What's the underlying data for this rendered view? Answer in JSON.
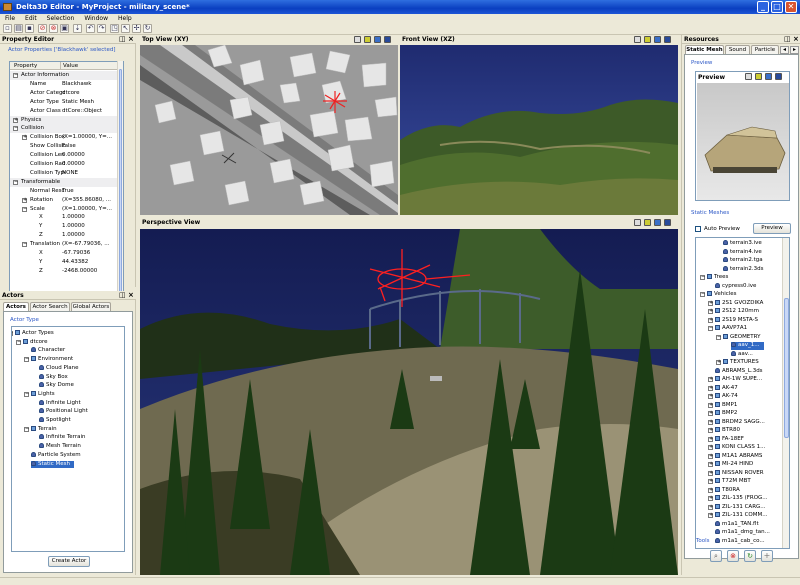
{
  "window": {
    "title": "Delta3D Editor - MyProject - military_scene*",
    "min": "_",
    "max": "□",
    "close": "✕"
  },
  "menu": [
    "File",
    "Edit",
    "Selection",
    "Window",
    "Help"
  ],
  "property_editor": {
    "title": "Property Editor",
    "subtitle": "Actor Properties ['Blackhawk' selected]",
    "col_property": "Property",
    "col_value": "Value",
    "rows": [
      {
        "k": "Actor Information",
        "v": "",
        "level": 0,
        "group": true,
        "exp": "−"
      },
      {
        "k": "Name",
        "v": "Blackhawk",
        "level": 1
      },
      {
        "k": "Actor Category",
        "v": "dtcore",
        "level": 1
      },
      {
        "k": "Actor Type",
        "v": "Static Mesh",
        "level": 1
      },
      {
        "k": "Actor Class",
        "v": "dtCore::Object",
        "level": 1
      },
      {
        "k": "Physics",
        "v": "",
        "level": 0,
        "group": true,
        "exp": "+"
      },
      {
        "k": "Collision",
        "v": "",
        "level": 0,
        "group": true,
        "exp": "−"
      },
      {
        "k": "Collision Box",
        "v": "(X=1.00000, Y=...",
        "level": 1,
        "exp": "+"
      },
      {
        "k": "Show Collisio...",
        "v": "False",
        "level": 1
      },
      {
        "k": "Collision Length",
        "v": "0.00000",
        "level": 1
      },
      {
        "k": "Collision Radius",
        "v": "0.00000",
        "level": 1
      },
      {
        "k": "Collision Type",
        "v": "NONE",
        "level": 1
      },
      {
        "k": "Transformable",
        "v": "",
        "level": 0,
        "group": true,
        "exp": "−"
      },
      {
        "k": "Normal Resc...",
        "v": "True",
        "level": 1
      },
      {
        "k": "Rotation",
        "v": "(X=355.86080, ...",
        "level": 1,
        "exp": "+"
      },
      {
        "k": "Scale",
        "v": "(X=1.00000, Y=...",
        "level": 1,
        "exp": "−"
      },
      {
        "k": "X",
        "v": "1.00000",
        "level": 2
      },
      {
        "k": "Y",
        "v": "1.00000",
        "level": 2
      },
      {
        "k": "Z",
        "v": "1.00000",
        "level": 2
      },
      {
        "k": "Translation",
        "v": "(X=-67.79036, ...",
        "level": 1,
        "exp": "−"
      },
      {
        "k": "X",
        "v": "-67.79036",
        "level": 2
      },
      {
        "k": "Y",
        "v": "44.43382",
        "level": 2
      },
      {
        "k": "Z",
        "v": "-2468.00000",
        "level": 2
      }
    ]
  },
  "actors": {
    "title": "Actors",
    "tabs": [
      "Actors",
      "Actor Search",
      "Global Actors"
    ],
    "group_label": "Actor Type",
    "create_button": "Create Actor",
    "tree": [
      {
        "t": "Actor Types",
        "l": 0,
        "icon": "folder",
        "exp": "−"
      },
      {
        "t": "dtcore",
        "l": 1,
        "icon": "folder",
        "exp": "−"
      },
      {
        "t": "Character",
        "l": 2,
        "icon": "person"
      },
      {
        "t": "Environment",
        "l": 2,
        "icon": "folder",
        "exp": "−"
      },
      {
        "t": "Cloud Plane",
        "l": 3,
        "icon": "person"
      },
      {
        "t": "Sky Box",
        "l": 3,
        "icon": "person"
      },
      {
        "t": "Sky Dome",
        "l": 3,
        "icon": "person"
      },
      {
        "t": "Lights",
        "l": 2,
        "icon": "folder",
        "exp": "−"
      },
      {
        "t": "Infinite Light",
        "l": 3,
        "icon": "person"
      },
      {
        "t": "Positional Light",
        "l": 3,
        "icon": "person"
      },
      {
        "t": "Spotlight",
        "l": 3,
        "icon": "person"
      },
      {
        "t": "Terrain",
        "l": 2,
        "icon": "folder",
        "exp": "−"
      },
      {
        "t": "Infinite Terrain",
        "l": 3,
        "icon": "person"
      },
      {
        "t": "Mesh Terrain",
        "l": 3,
        "icon": "person"
      },
      {
        "t": "Particle System",
        "l": 2,
        "icon": "person"
      },
      {
        "t": "Static Mesh",
        "l": 2,
        "icon": "person",
        "selected": true
      }
    ]
  },
  "views": {
    "top": "Top View (XY)",
    "front": "Front View (XZ)",
    "perspective": "Perspective View"
  },
  "resources": {
    "title": "Resources",
    "tabs": [
      "Static Mesh",
      "Sound",
      "Particle"
    ],
    "preview_group": "Preview",
    "preview_title": "Preview",
    "static_meshes": "Static Meshes",
    "auto_preview": "Auto Preview",
    "preview_button": "Preview",
    "tools": "Tools",
    "tree": [
      {
        "t": "terrain3.ive",
        "l": 3,
        "icon": "person"
      },
      {
        "t": "terrain4.ive",
        "l": 3,
        "icon": "person"
      },
      {
        "t": "terrain2.tga",
        "l": 3,
        "icon": "person"
      },
      {
        "t": "terrain2.3ds",
        "l": 3,
        "icon": "person"
      },
      {
        "t": "Trees",
        "l": 1,
        "icon": "folder",
        "exp": "−"
      },
      {
        "t": "cypress0.ive",
        "l": 2,
        "icon": "person"
      },
      {
        "t": "Vehicles",
        "l": 1,
        "icon": "folder",
        "exp": "−"
      },
      {
        "t": "2S1 GVOZDIKA",
        "l": 2,
        "icon": "folder",
        "exp": "+"
      },
      {
        "t": "2S12 120mm",
        "l": 2,
        "icon": "folder",
        "exp": "+"
      },
      {
        "t": "2S19 MSTA-S",
        "l": 2,
        "icon": "folder",
        "exp": "+"
      },
      {
        "t": "AAVP7A1",
        "l": 2,
        "icon": "folder",
        "exp": "−"
      },
      {
        "t": "GEOMETRY",
        "l": 3,
        "icon": "folder",
        "exp": "−"
      },
      {
        "t": "aav_1...",
        "l": 4,
        "icon": "person",
        "selected": true
      },
      {
        "t": "aav...",
        "l": 4,
        "icon": "person"
      },
      {
        "t": "TEXTURES",
        "l": 3,
        "icon": "folder",
        "exp": "+"
      },
      {
        "t": "ABRAMS_L.3ds",
        "l": 2,
        "icon": "person"
      },
      {
        "t": "AH-1W SUPE...",
        "l": 2,
        "icon": "folder",
        "exp": "+"
      },
      {
        "t": "AK-47",
        "l": 2,
        "icon": "folder",
        "exp": "+"
      },
      {
        "t": "AK-74",
        "l": 2,
        "icon": "folder",
        "exp": "+"
      },
      {
        "t": "BMP1",
        "l": 2,
        "icon": "folder",
        "exp": "+"
      },
      {
        "t": "BMP2",
        "l": 2,
        "icon": "folder",
        "exp": "+"
      },
      {
        "t": "BRDM2 SAGG...",
        "l": 2,
        "icon": "folder",
        "exp": "+"
      },
      {
        "t": "BTR80",
        "l": 2,
        "icon": "folder",
        "exp": "+"
      },
      {
        "t": "FA-18EF",
        "l": 2,
        "icon": "folder",
        "exp": "+"
      },
      {
        "t": "KONI CLASS 1...",
        "l": 2,
        "icon": "folder",
        "exp": "+"
      },
      {
        "t": "M1A1 ABRAMS",
        "l": 2,
        "icon": "folder",
        "exp": "+"
      },
      {
        "t": "MI-24 HIND",
        "l": 2,
        "icon": "folder",
        "exp": "+"
      },
      {
        "t": "NISSAN ROVER",
        "l": 2,
        "icon": "folder",
        "exp": "+"
      },
      {
        "t": "T72M MBT",
        "l": 2,
        "icon": "folder",
        "exp": "+"
      },
      {
        "t": "T80RA",
        "l": 2,
        "icon": "folder",
        "exp": "+"
      },
      {
        "t": "ZIL-135 (FROG...",
        "l": 2,
        "icon": "folder",
        "exp": "+"
      },
      {
        "t": "ZIL-131 CARG...",
        "l": 2,
        "icon": "folder",
        "exp": "+"
      },
      {
        "t": "ZIL-131 COMM...",
        "l": 2,
        "icon": "folder",
        "exp": "+"
      },
      {
        "t": "m1a1_TAN.flt",
        "l": 2,
        "icon": "person"
      },
      {
        "t": "m1a1_dmg_tan...",
        "l": 2,
        "icon": "person"
      },
      {
        "t": "m1a1_cab_co...",
        "l": 2,
        "icon": "person"
      }
    ]
  }
}
